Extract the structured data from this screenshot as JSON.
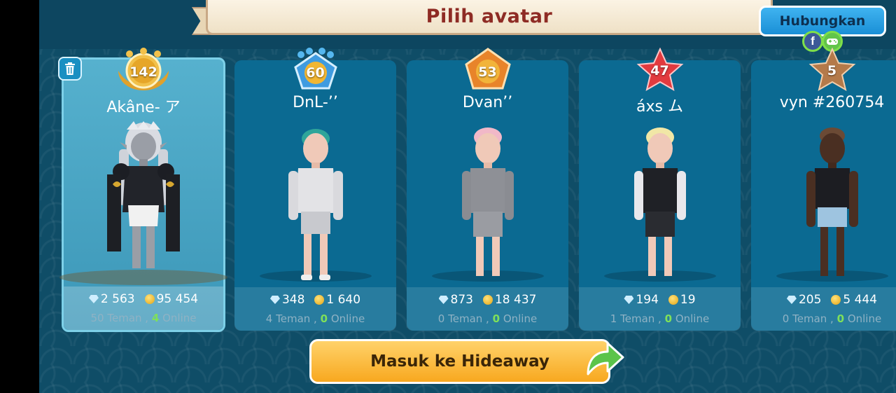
{
  "header": {
    "title": "Pilih avatar"
  },
  "connect": {
    "label": "Hubungkan",
    "facebook_glyph": "f"
  },
  "avatars": [
    {
      "name": "Akâne- ア",
      "level": "142",
      "gems": "2 563",
      "coins": "95 454",
      "friends": "50",
      "online": "4",
      "friends_suffix": "Teman ,",
      "online_label": "Online",
      "badge": "gold-laurel"
    },
    {
      "name": "DnL-’’",
      "level": "60",
      "gems": "348",
      "coins": "1 640",
      "friends": "4",
      "online": "0",
      "friends_suffix": "Teman ,",
      "online_label": "Online",
      "badge": "blue-pentagon"
    },
    {
      "name": "Dvan’’",
      "level": "53",
      "gems": "873",
      "coins": "18 437",
      "friends": "0",
      "online": "0",
      "friends_suffix": "Teman ,",
      "online_label": "Online",
      "badge": "orange-pentagon"
    },
    {
      "name": "áxs ム",
      "level": "47",
      "gems": "194",
      "coins": "19",
      "friends": "1",
      "online": "0",
      "friends_suffix": "Teman ,",
      "online_label": "Online",
      "badge": "red-star"
    },
    {
      "name": "vyn #260754",
      "level": "5",
      "gems": "205",
      "coins": "5 444",
      "friends": "0",
      "online": "0",
      "friends_suffix": "Teman ,",
      "online_label": "Online",
      "badge": "bronze-star"
    }
  ],
  "enter": {
    "label": "Masuk ke Hideaway"
  },
  "colors": {
    "background": "#0f4d67",
    "card": "#0b6a92",
    "selected_card": "#4aa6c4",
    "enter_button": "#f8a81f",
    "connect_button": "#1a8fd6",
    "title": "#8e2b24",
    "online_green": "#7fe05a"
  }
}
